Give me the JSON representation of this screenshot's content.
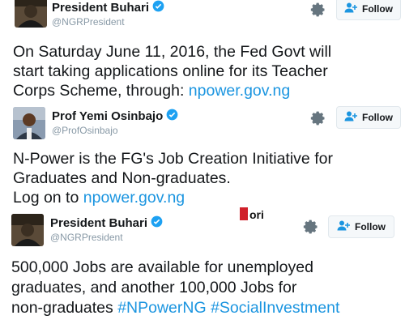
{
  "tweets": [
    {
      "name": "President Buhari",
      "handle": "@NGRPresident",
      "follow_label": "Follow",
      "lines": [
        "On Saturday June 11, 2016, the Fed Govt will",
        "start taking applications online for its Teacher",
        "Corps Scheme, through: "
      ],
      "link": "npower.gov.ng"
    },
    {
      "name": "Prof Yemi Osinbajo",
      "handle": "@ProfOsinbajo",
      "follow_label": "Follow",
      "lines": [
        "N-Power is the FG's Job Creation Initiative for",
        "Graduates and Non-graduates.",
        "Log on to "
      ],
      "link": "npower.gov.ng"
    },
    {
      "name": "President Buhari",
      "handle": "@NGRPresident",
      "follow_label": "Follow",
      "lines": [
        "500,000 Jobs are available for unemployed",
        "graduates, and another 100,000 Jobs for",
        "non-graduates "
      ],
      "hashtags": [
        "#NPowerNG",
        "#SocialInvestment"
      ]
    }
  ],
  "watermark_text": "Tori",
  "colors": {
    "link": "#1b95e0",
    "verified": "#1da1f2",
    "muted": "#8899a6"
  },
  "icons": [
    "verified-badge-icon",
    "gear-icon",
    "follow-person-icon",
    "avatar"
  ]
}
